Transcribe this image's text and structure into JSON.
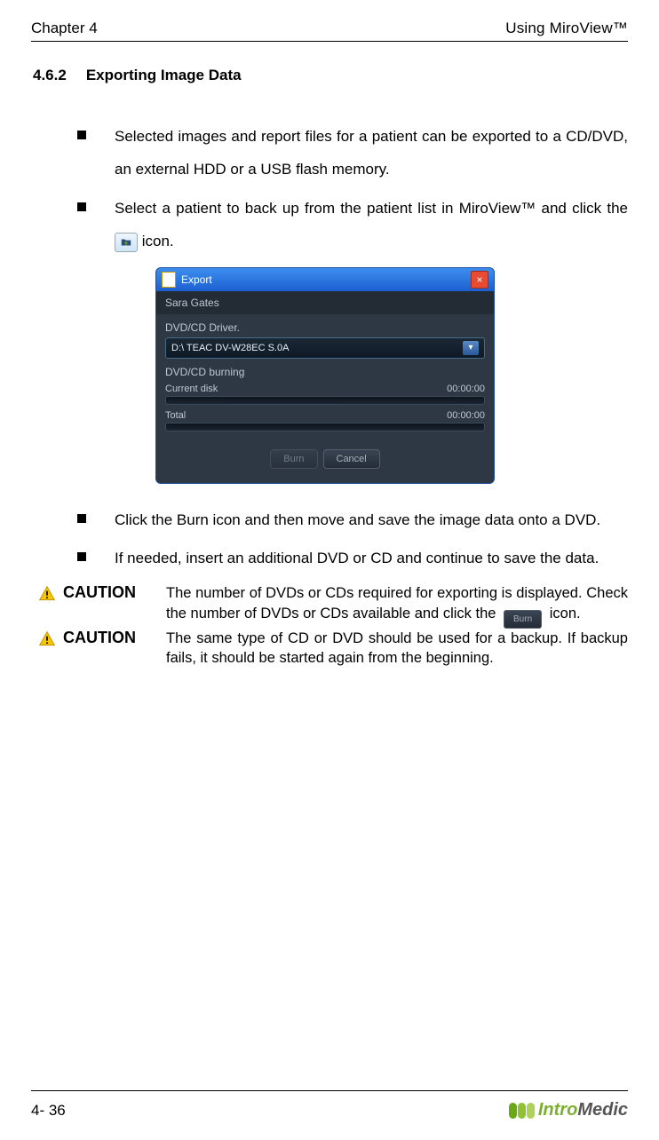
{
  "header": {
    "left": "Chapter 4",
    "right": "Using MiroView™"
  },
  "section": {
    "number": "4.6.2",
    "title": "Exporting Image Data"
  },
  "bullets": [
    "Selected images and report files for a patient can be exported to a CD/DVD, an external HDD or a USB flash memory.",
    {
      "pre": "Select a patient to back up from the patient list in MiroView™ and click the ",
      "post": " icon."
    },
    "Click the Burn icon and then move and save the image data onto a DVD.",
    "If needed, insert an additional DVD or CD and continue to save the data."
  ],
  "dialog": {
    "title": "Export",
    "patient": "Sara Gates",
    "driver_label": "DVD/CD Driver.",
    "driver_value": "D:\\ TEAC    DV-W28EC      S.0A",
    "burning_label": "DVD/CD burning",
    "current_label": "Current disk",
    "current_time": "00:00:00",
    "total_label": "Total",
    "total_time": "00:00:00",
    "burn_btn": "Burn",
    "cancel_btn": "Cancel"
  },
  "cautions": [
    {
      "label": "CAUTION",
      "pre": "The number of DVDs or CDs required for exporting is displayed. Check the number of DVDs or CDs available and click the ",
      "chip": "Burn",
      "post": " icon."
    },
    {
      "label": "CAUTION",
      "text": "The same type of CD or DVD should be used for a backup. If backup fails, it should be started again from the beginning."
    }
  ],
  "footer": {
    "page": "4- 36",
    "logo_a": "Intro",
    "logo_b": "Medic"
  }
}
